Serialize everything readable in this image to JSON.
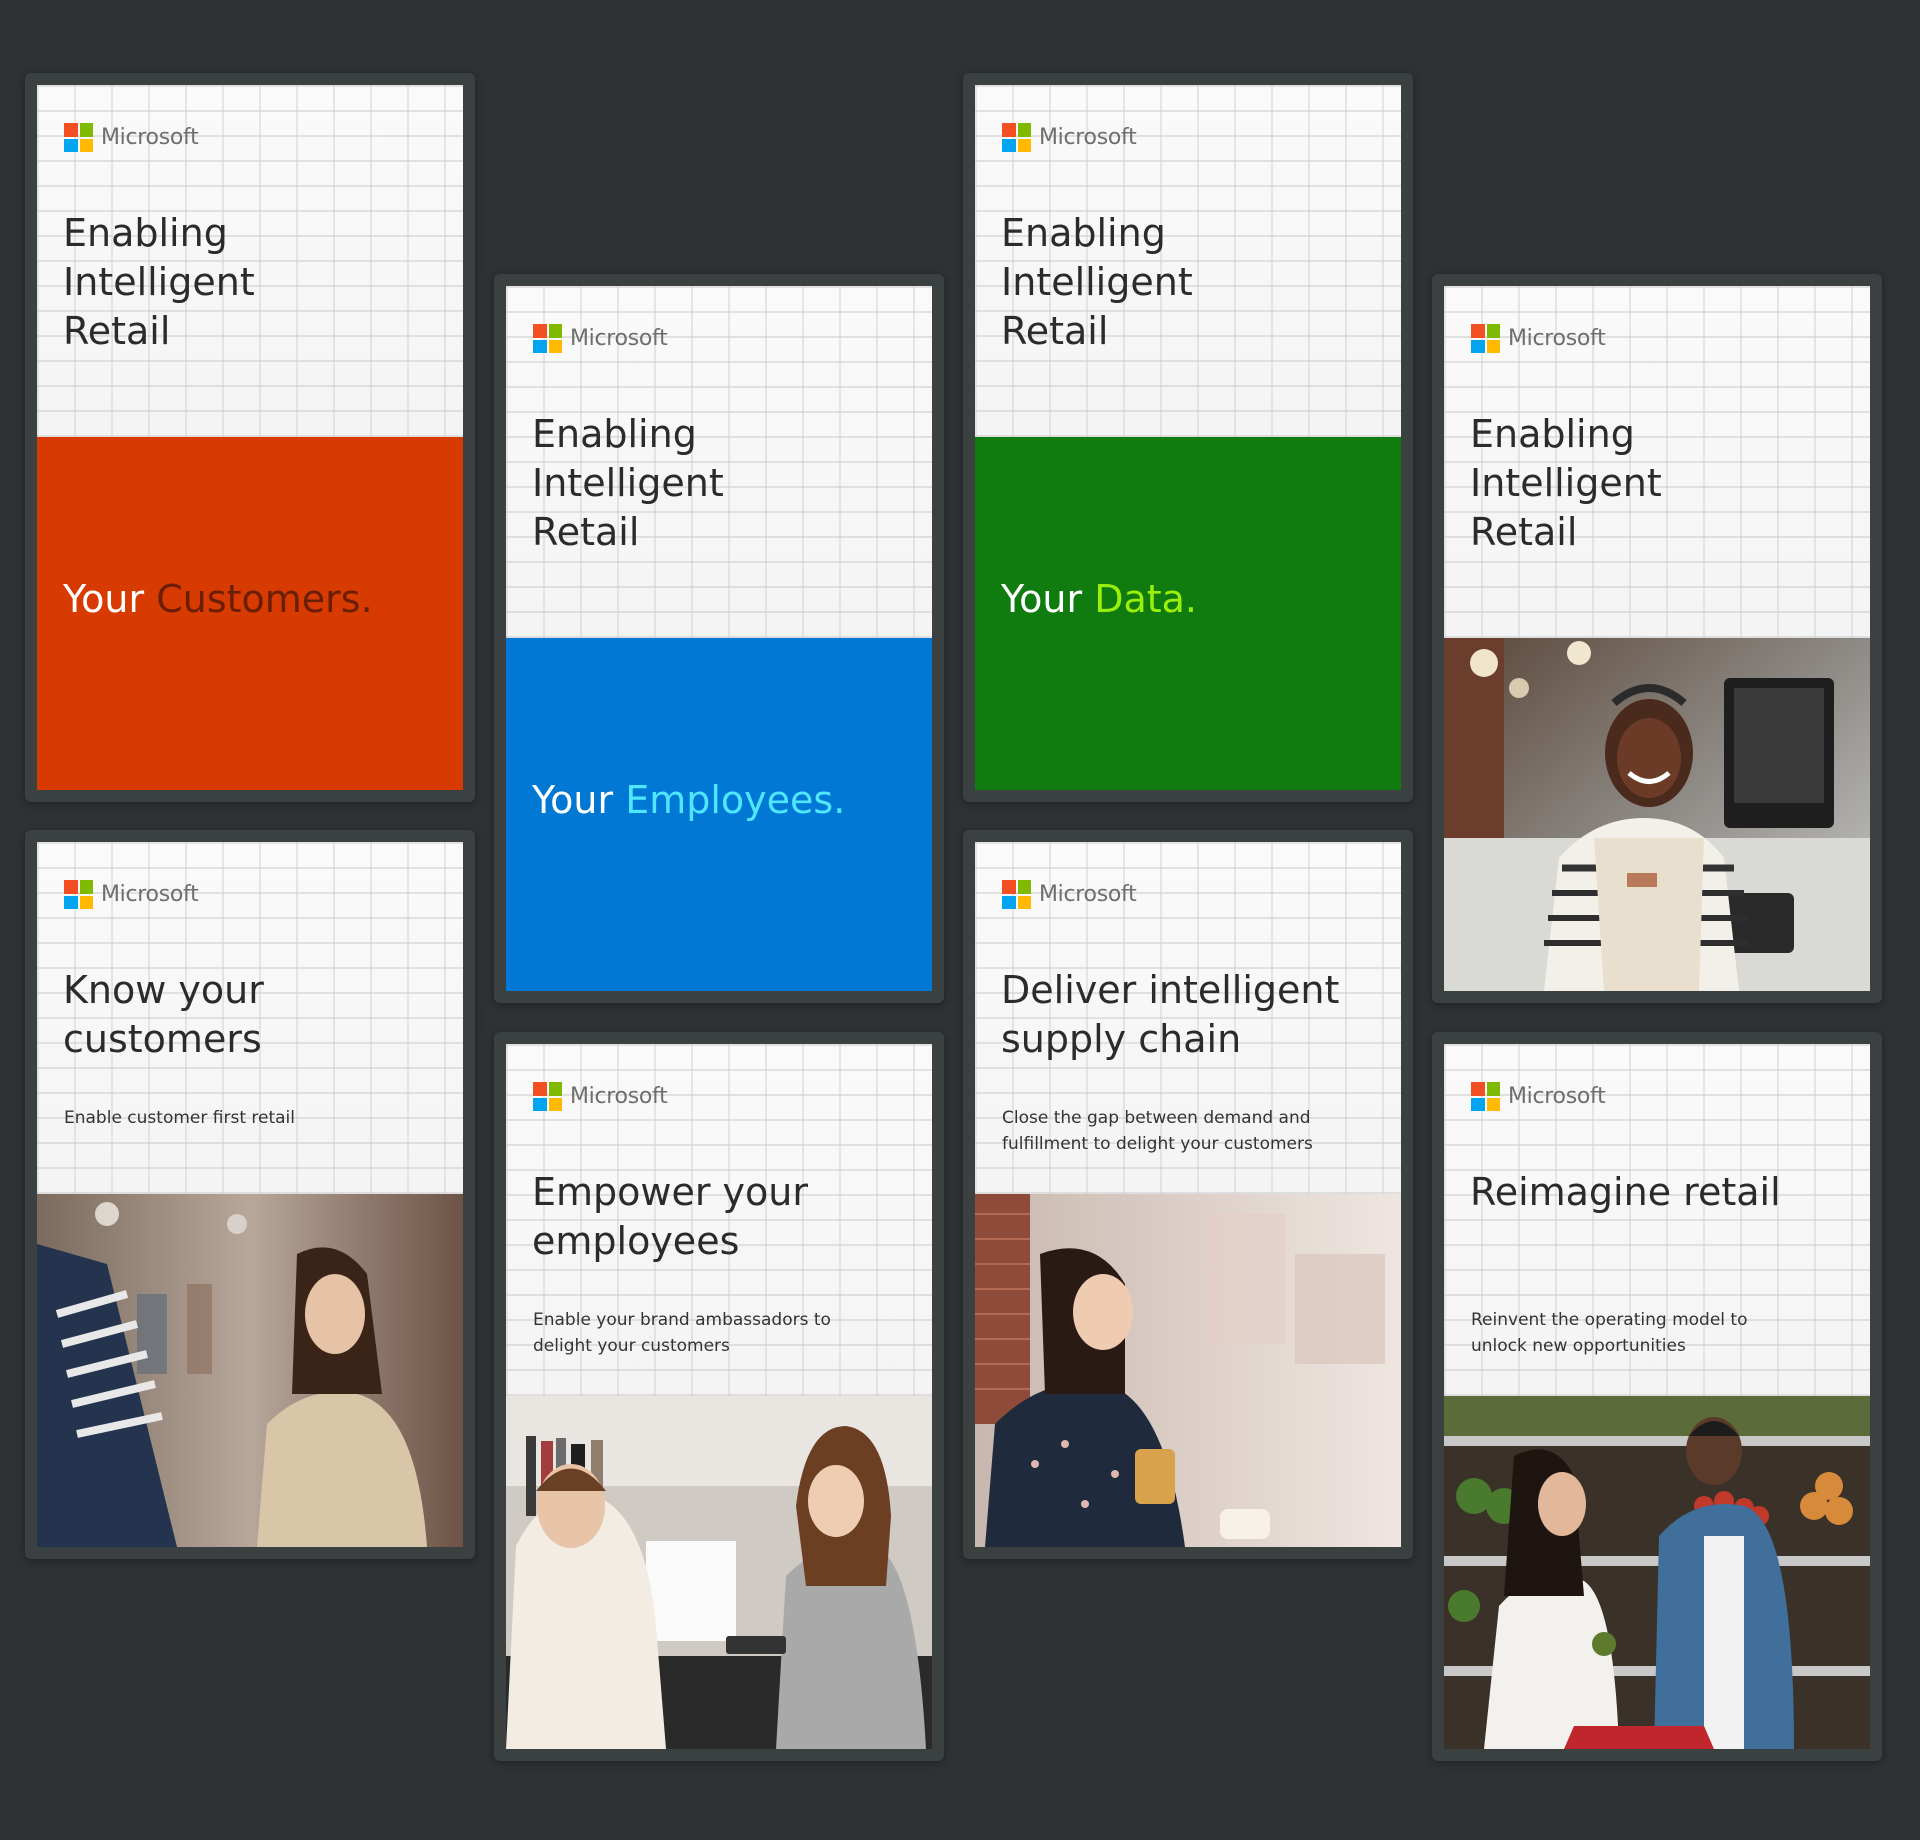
{
  "brand": {
    "name": "Microsoft",
    "colors": {
      "red": "#f25022",
      "green": "#7fba00",
      "blue": "#00a4ef",
      "yellow": "#ffb900"
    }
  },
  "cards": {
    "customers": {
      "headline": "Enabling Intelligent Retail",
      "tag_lead": "Your ",
      "tag_accent": "Customers.",
      "bg": "#d83b01",
      "accent": "#6b1e06"
    },
    "employees": {
      "headline": "Enabling Intelligent Retail",
      "tag_lead": "Your ",
      "tag_accent": "Employees.",
      "bg": "#0078d4",
      "accent": "#50e6ff"
    },
    "data": {
      "headline": "Enabling Intelligent Retail",
      "tag_lead": "Your ",
      "tag_accent": "Data.",
      "bg": "#107c10",
      "accent": "#9bf00b"
    },
    "cashier": {
      "headline": "Enabling Intelligent Retail",
      "photo": "smiling-cashier-photo"
    },
    "know": {
      "headline": "Know your customers",
      "subtext": "Enable customer first retail",
      "photo": "shopper-browsing-photo"
    },
    "empower": {
      "headline": "Empower your employees",
      "subtext": "Enable your brand ambassadors to delight your customers",
      "photo": "checkout-counter-photo"
    },
    "supply": {
      "headline": "Deliver intelligent supply chain",
      "subtext": "Close the gap between demand and fulfillment to delight your customers",
      "photo": "woman-with-phone-photo"
    },
    "reimagine": {
      "headline": "Reimagine retail",
      "subtext": "Reinvent the operating model to unlock new opportunities",
      "photo": "grocery-couple-photo"
    }
  }
}
